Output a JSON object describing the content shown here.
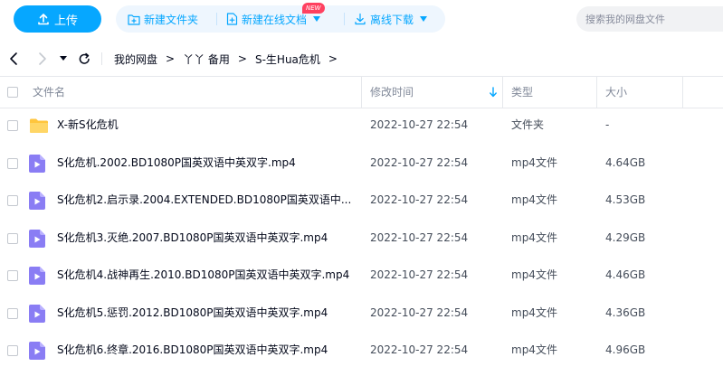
{
  "toolbar": {
    "upload_label": "上传",
    "new_folder_label": "新建文件夹",
    "new_online_doc_label": "新建在线文档",
    "new_badge": "NEW",
    "offline_download_label": "离线下载",
    "search_placeholder": "搜索我的网盘文件",
    "accent_color": "#06a7ff"
  },
  "breadcrumb": {
    "items": [
      "我的网盘",
      "丫丫 备用",
      "S-生Hua危机"
    ],
    "separator": ">"
  },
  "table": {
    "columns": {
      "name": "文件名",
      "modified": "修改时间",
      "type": "类型",
      "size": "大小"
    },
    "sort_icon": "arrow-down-icon",
    "rows": [
      {
        "icon": "folder-icon",
        "name": "X-新S化危机",
        "modified": "2022-10-27 22:54",
        "type": "文件夹",
        "size": "-"
      },
      {
        "icon": "video-file-icon",
        "name": "S化危机.2002.BD1080P国英双语中英双字.mp4",
        "modified": "2022-10-27 22:54",
        "type": "mp4文件",
        "size": "4.64GB"
      },
      {
        "icon": "video-file-icon",
        "name": "S化危机2.启示录.2004.EXTENDED.BD1080P国英双语中...",
        "modified": "2022-10-27 22:54",
        "type": "mp4文件",
        "size": "4.53GB"
      },
      {
        "icon": "video-file-icon",
        "name": "S化危机3.灭绝.2007.BD1080P国英双语中英双字.mp4",
        "modified": "2022-10-27 22:54",
        "type": "mp4文件",
        "size": "4.29GB"
      },
      {
        "icon": "video-file-icon",
        "name": "S化危机4.战神再生.2010.BD1080P国英双语中英双字.mp4",
        "modified": "2022-10-27 22:54",
        "type": "mp4文件",
        "size": "4.46GB"
      },
      {
        "icon": "video-file-icon",
        "name": "S化危机5.惩罚.2012.BD1080P国英双语中英双字.mp4",
        "modified": "2022-10-27 22:54",
        "type": "mp4文件",
        "size": "4.36GB"
      },
      {
        "icon": "video-file-icon",
        "name": "S化危机6.终章.2016.BD1080P国英双语中英双字.mp4",
        "modified": "2022-10-27 22:54",
        "type": "mp4文件",
        "size": "4.96GB"
      }
    ]
  }
}
